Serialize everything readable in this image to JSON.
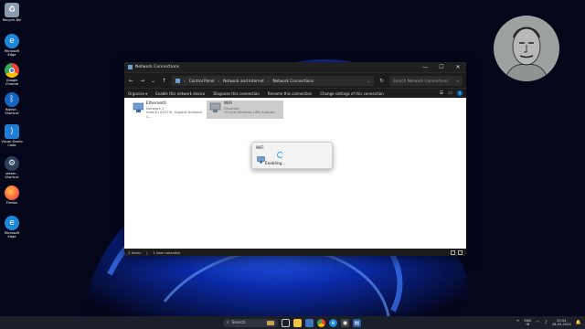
{
  "desktop": {
    "icons": [
      {
        "label": "Recycle Bin",
        "icon": "recycle-bin-icon",
        "color": "#8a9bb0"
      },
      {
        "label": "Microsoft Edge",
        "icon": "edge-icon",
        "color": "#1e88d8"
      },
      {
        "label": "Google Chrome",
        "icon": "chrome-icon",
        "color": "#e94235"
      },
      {
        "label": "Rajesh - Shortcut",
        "icon": "bluetooth-icon",
        "color": "#1565c0"
      },
      {
        "label": "Visual Studio Code",
        "icon": "vscode-icon",
        "color": "#1f7ed4"
      },
      {
        "label": "steam - Shortcut",
        "icon": "steam-icon",
        "color": "#2b3e5a"
      },
      {
        "label": "Firefox",
        "icon": "firefox-icon",
        "color": "#ff7139"
      },
      {
        "label": "Microsoft Edge",
        "icon": "edge-icon",
        "color": "#1e88d8"
      }
    ]
  },
  "window": {
    "title": "Network Connections",
    "minimize": "—",
    "maximize": "☐",
    "close": "✕",
    "breadcrumb": [
      "Control Panel",
      "Network and Internet",
      "Network Connections"
    ],
    "search_placeholder": "Search Network Connections",
    "commands": [
      "Organise ▾",
      "Enable this network device",
      "Diagnose this connection",
      "Rename this connection",
      "Change settings of this connection"
    ],
    "adapters": [
      {
        "name": "Ethernet0",
        "status": "Network 2",
        "device": "Intel(R) 82574L Gigabit Network C...",
        "selected": false
      },
      {
        "name": "WiFi",
        "status": "Disabled",
        "device": "TP-Link Wireless USB Adapter",
        "selected": true
      }
    ],
    "status_bar": {
      "items": "2 items",
      "selected": "1 item selected"
    }
  },
  "popup": {
    "title": "WiFi",
    "status": "Enabling..."
  },
  "taskbar": {
    "search_label": "Search",
    "language": {
      "line1": "ENG",
      "line2": "IN"
    },
    "time": "20:54",
    "date": "26-03-2024"
  },
  "colors": {
    "accent": "#0067c0",
    "wallpaper_blue": "#1a5cff"
  }
}
